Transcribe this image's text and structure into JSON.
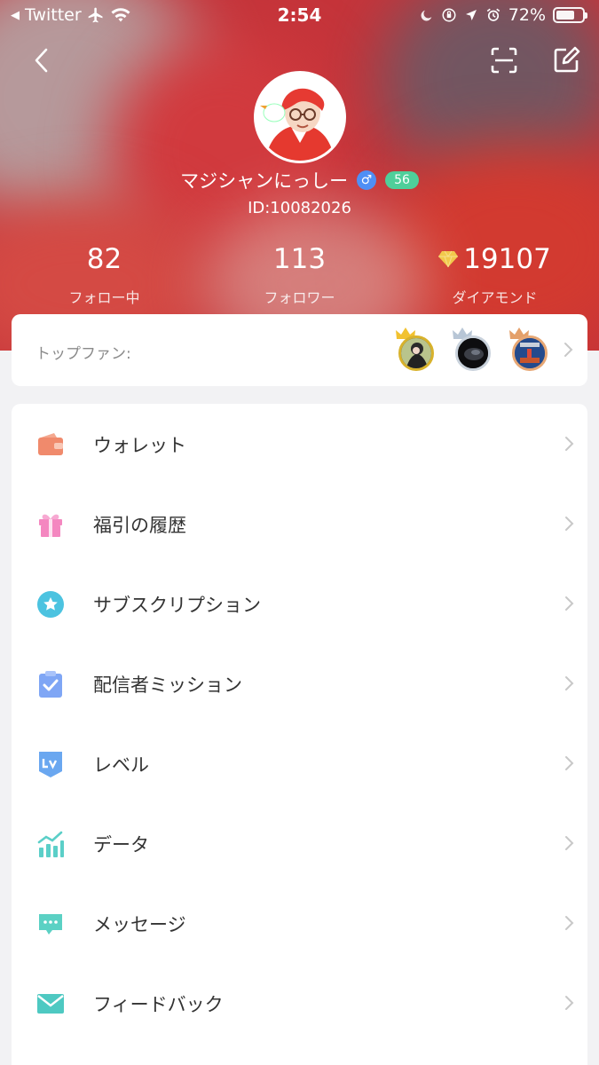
{
  "status_bar": {
    "back_app": "Twitter",
    "time": "2:54",
    "battery": "72%",
    "battery_level": 0.72
  },
  "profile": {
    "name": "マジシャンにっしー",
    "gender_symbol": "♂",
    "level": "56",
    "id": "ID:10082026"
  },
  "stats": [
    {
      "value": "82",
      "label": "フォロー中"
    },
    {
      "value": "113",
      "label": "フォロワー"
    },
    {
      "value": "19107",
      "label": "ダイアモンド"
    }
  ],
  "top_fans": {
    "label": "トップファン:"
  },
  "menu": [
    {
      "label": "ウォレット",
      "icon": "wallet-icon",
      "color": "#f08a6c"
    },
    {
      "label": "福引の履歴",
      "icon": "gift-icon",
      "color": "#f487c0"
    },
    {
      "label": "サブスクリプション",
      "icon": "star-icon",
      "color": "#4cc3e0"
    },
    {
      "label": "配信者ミッション",
      "icon": "clipboard-check-icon",
      "color": "#7fa6f5"
    },
    {
      "label": "レベル",
      "icon": "level-icon",
      "color": "#6aa7f0"
    },
    {
      "label": "データ",
      "icon": "chart-icon",
      "color": "#5bcfc8"
    },
    {
      "label": "メッセージ",
      "icon": "message-icon",
      "color": "#5bd1c4"
    },
    {
      "label": "フィードバック",
      "icon": "mail-icon",
      "color": "#4ec9c2"
    }
  ]
}
